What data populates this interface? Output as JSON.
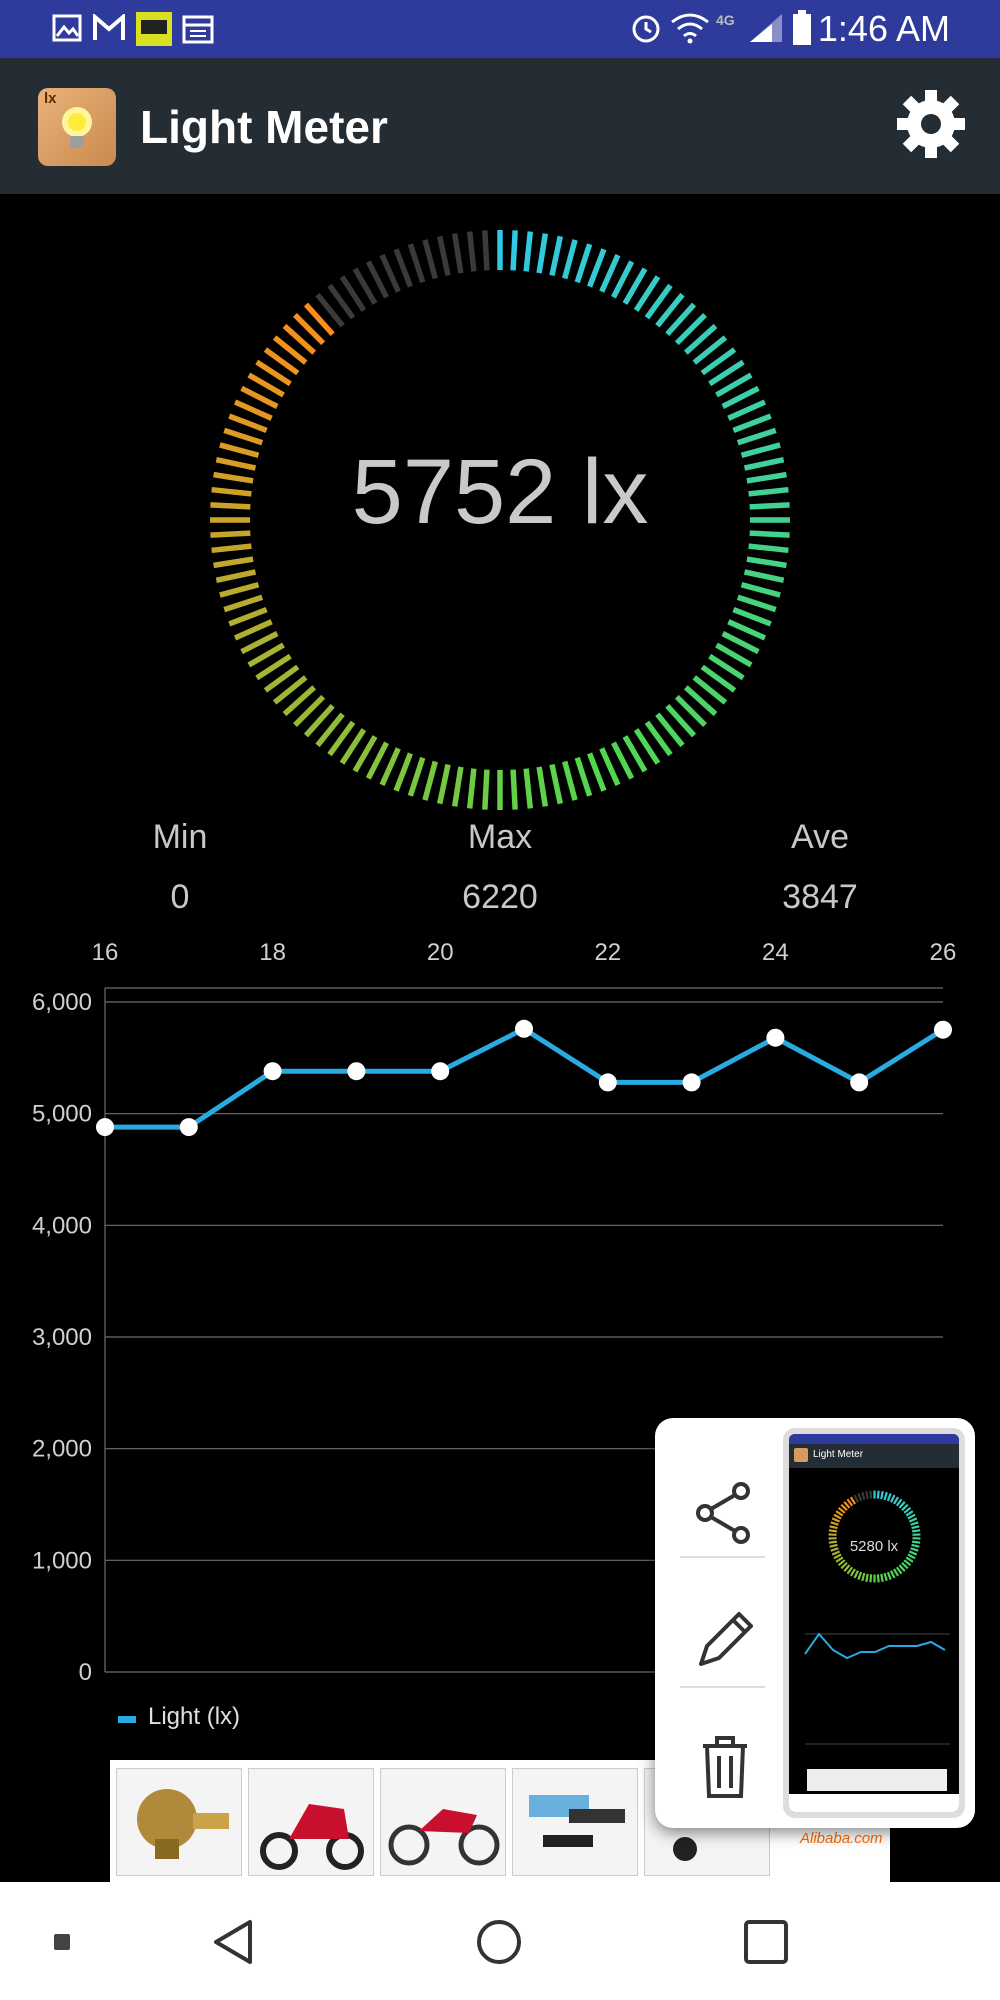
{
  "status_bar": {
    "time": "1:46 AM",
    "network": "4G",
    "left_icons": [
      "gallery-icon",
      "gmail-icon",
      "straight-talk-icon",
      "calendar-icon"
    ],
    "right_icons": [
      "alarm-icon",
      "wifi-icon",
      "signal-icon",
      "battery-icon"
    ]
  },
  "app_bar": {
    "title": "Light Meter",
    "logo_badge": "lx",
    "settings_icon": "gear-icon"
  },
  "gauge": {
    "reading": "5752 lx",
    "fill_fraction": 0.89,
    "colors": {
      "start": "#2fc9e6",
      "middle": "#52d84b",
      "end": "#ff8c1a",
      "empty": "#3a3a3a"
    }
  },
  "stats": {
    "min": {
      "label": "Min",
      "value": "0"
    },
    "max": {
      "label": "Max",
      "value": "6220"
    },
    "ave": {
      "label": "Ave",
      "value": "3847"
    }
  },
  "chart_data": {
    "type": "line",
    "x": [
      16,
      17,
      18,
      19,
      20,
      21,
      22,
      23,
      24,
      25,
      26
    ],
    "x_tick_labels": [
      "16",
      "18",
      "20",
      "22",
      "24",
      "26"
    ],
    "y_tick_labels": [
      "6,000",
      "5,000",
      "4,000",
      "3,000",
      "2,000",
      "1,000",
      "0"
    ],
    "xlim": [
      16,
      26
    ],
    "ylim": [
      0,
      6000
    ],
    "series": [
      {
        "name": "Light  (lx)",
        "color": "#29abe2",
        "values": [
          4880,
          4880,
          5380,
          5380,
          5380,
          5760,
          5280,
          5280,
          5680,
          5280,
          5752
        ]
      }
    ],
    "grid": true,
    "legend": "bottom-left"
  },
  "ad_strip": {
    "items": [
      "oil-pressure-switch",
      "electric-scooter",
      "motorcycle",
      "led-light-kit",
      "tool-parts"
    ],
    "brand": "Alibaba.com"
  },
  "screenshot_popup": {
    "actions": [
      "share-icon",
      "edit-icon",
      "delete-icon"
    ],
    "preview": {
      "title": "Light Meter",
      "reading": "5280 lx"
    }
  },
  "nav_bar": {
    "buttons": [
      "recents-dot",
      "back-icon",
      "home-icon",
      "overview-icon"
    ]
  }
}
